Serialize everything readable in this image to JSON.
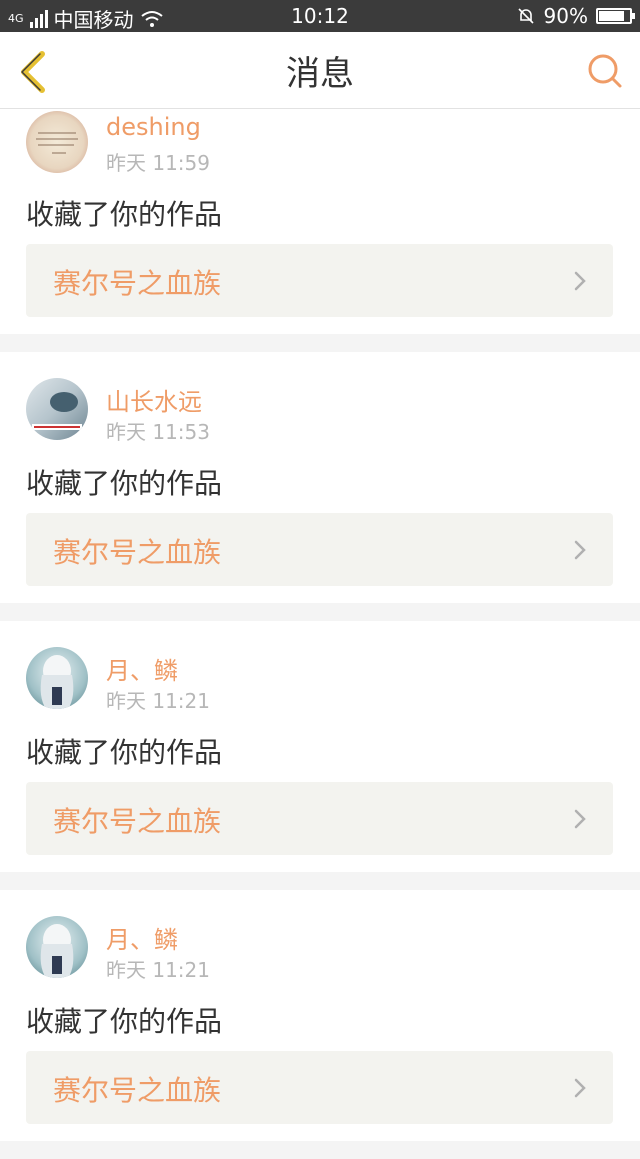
{
  "status_bar": {
    "network_type": "4G",
    "carrier": "中国移动",
    "time": "10:12",
    "battery": "90%",
    "battery_level": 0.9
  },
  "nav": {
    "title": "消息",
    "back_icon": "chevron-left-icon",
    "search_icon": "search-icon",
    "back_color": "#e5c032",
    "accent_color": "#ef9c67"
  },
  "messages": [
    {
      "user": "deshing",
      "time": "昨天 11:59",
      "action": "收藏了你的作品",
      "work": "赛尔号之血族"
    },
    {
      "user": "山长水远",
      "time": "昨天 11:53",
      "action": "收藏了你的作品",
      "work": "赛尔号之血族"
    },
    {
      "user": "月、鳞",
      "time": "昨天 11:21",
      "action": "收藏了你的作品",
      "work": "赛尔号之血族"
    },
    {
      "user": "月、鳞",
      "time": "昨天 11:21",
      "action": "收藏了你的作品",
      "work": "赛尔号之血族"
    }
  ]
}
